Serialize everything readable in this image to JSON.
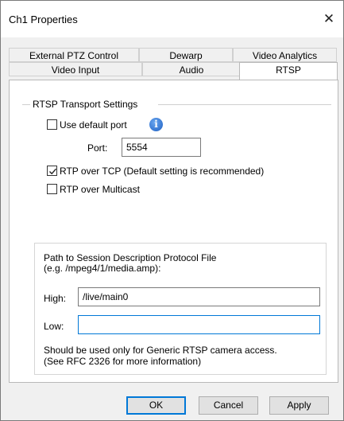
{
  "window": {
    "title": "Ch1 Properties",
    "close_glyph": "✕"
  },
  "tabs": {
    "row_top": [
      "External PTZ Control",
      "Dewarp",
      "Video Analytics"
    ],
    "row_bottom": [
      "Video Input",
      "Audio",
      "RTSP"
    ],
    "active": "RTSP"
  },
  "rtsp": {
    "group_title": "RTSP Transport Settings",
    "use_default_port": {
      "label": "Use default port",
      "checked": false
    },
    "info_icon": "i",
    "port_label": "Port:",
    "port_value": "5554",
    "rtp_over_tcp": {
      "label": "RTP over TCP (Default setting is recommended)",
      "checked": true
    },
    "rtp_over_multicast": {
      "label": "RTP over Multicast",
      "checked": false
    },
    "sdp": {
      "heading_line1": "Path to Session Description Protocol File",
      "heading_line2": "(e.g. /mpeg4/1/media.amp):",
      "high_label": "High:",
      "high_value": "/live/main0",
      "low_label": "Low:",
      "low_value": "",
      "note_line1": "Should be used only for Generic RTSP camera access.",
      "note_line2": "(See RFC 2326 for more information)"
    }
  },
  "buttons": {
    "ok": "OK",
    "cancel": "Cancel",
    "apply": "Apply"
  }
}
